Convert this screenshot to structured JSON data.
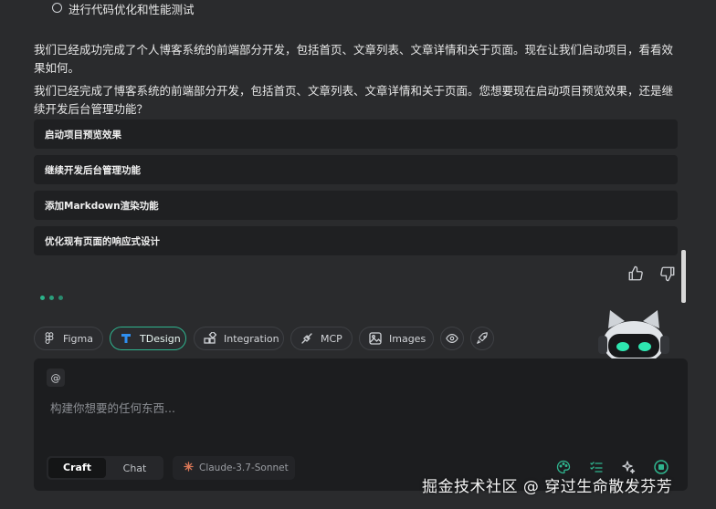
{
  "todo": {
    "label": "进行代码优化和性能测试"
  },
  "messages": [
    "我们已经成功完成了个人博客系统的前端部分开发，包括首页、文章列表、文章详情和关于页面。现在让我们启动项目，看看效果如何。",
    "我们已经完成了博客系统的前端部分开发，包括首页、文章列表、文章详情和关于页面。您想要现在启动项目预览效果，还是继续开发后台管理功能？"
  ],
  "options": [
    "启动项目预览效果",
    "继续开发后台管理功能",
    "添加Markdown渲染功能",
    "优化现有页面的响应式设计"
  ],
  "feedback": {
    "like_icon": "thumbs-up-icon",
    "dislike_icon": "thumbs-down-icon"
  },
  "toolbar": {
    "chips": [
      {
        "label": "Figma",
        "icon": "figma-icon"
      },
      {
        "label": "TDesign",
        "icon": "tdesign-icon",
        "active": true
      },
      {
        "label": "Integration",
        "icon": "integration-icon"
      },
      {
        "label": "MCP",
        "icon": "mcp-icon"
      },
      {
        "label": "Images",
        "icon": "image-icon"
      }
    ],
    "preview_icon": "eye-icon",
    "deploy_icon": "rocket-icon"
  },
  "input": {
    "mention_symbol": "@",
    "placeholder": "构建你想要的任何东西..."
  },
  "mode": {
    "craft_label": "Craft",
    "chat_label": "Chat",
    "selected": "Craft"
  },
  "model": {
    "label": "Claude-3.7-Sonnet"
  },
  "colors": {
    "accent": "#2fb58f",
    "background": "#2a2b2d",
    "panel": "#1c1d1f"
  },
  "watermark": "掘金技术社区 @ 穿过生命散发芬芳"
}
